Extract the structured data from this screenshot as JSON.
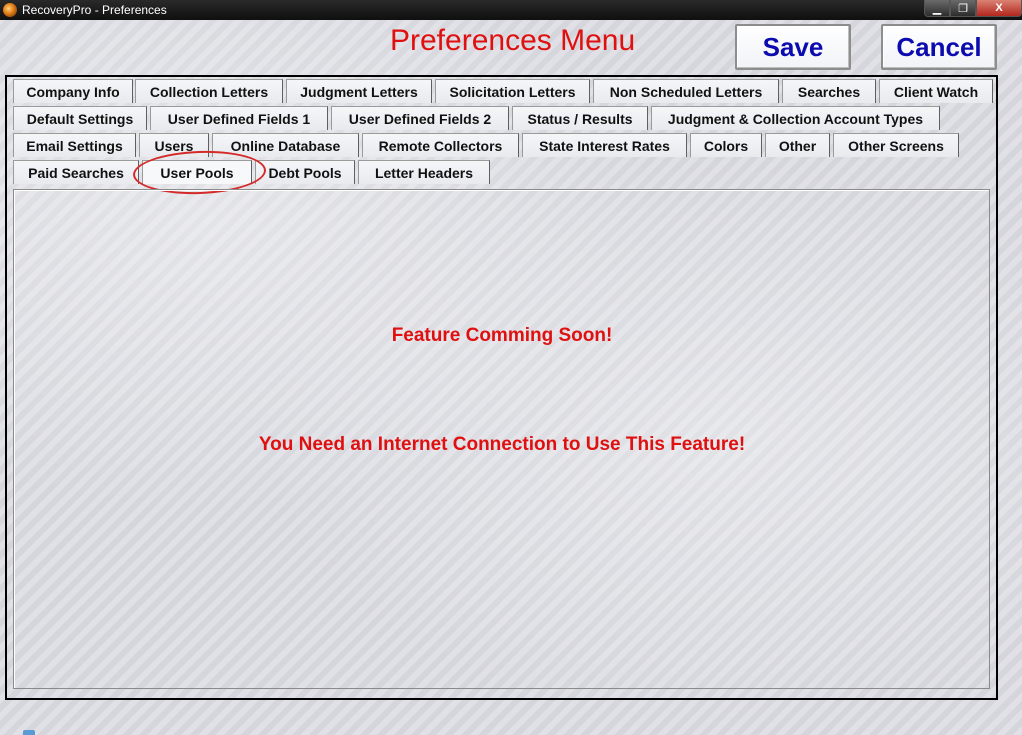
{
  "window": {
    "title": "RecoveryPro - Preferences",
    "close_label": "X"
  },
  "header": {
    "title": "Preferences Menu",
    "save_label": "Save",
    "cancel_label": "Cancel"
  },
  "tabs": [
    "Company Info",
    "Collection Letters",
    "Judgment Letters",
    "Solicitation Letters",
    "Non Scheduled Letters",
    "Searches",
    "Client Watch",
    "Default Settings",
    "User Defined Fields 1",
    "User Defined Fields 2",
    "Status / Results",
    "Judgment & Collection Account Types",
    "Email Settings",
    "Users",
    "Online Database",
    "Remote Collectors",
    "State Interest Rates",
    "Colors",
    "Other",
    "Other Screens",
    "Paid Searches",
    "User Pools",
    "Debt Pools",
    "Letter Headers"
  ],
  "selected_tab": "User Pools",
  "panel": {
    "message1": "Feature Comming Soon!",
    "message2": "You Need an Internet Connection to Use This Feature!"
  },
  "colors": {
    "accent_red": "#e01010",
    "button_text_blue": "#0b0bb0"
  }
}
